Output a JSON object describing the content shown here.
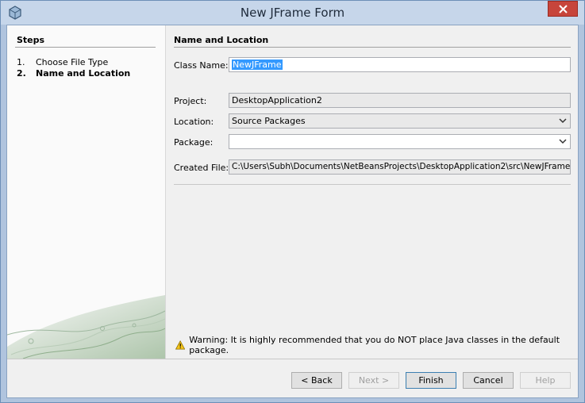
{
  "window": {
    "title": "New JFrame Form"
  },
  "steps": {
    "title": "Steps",
    "items": [
      {
        "num": "1.",
        "label": "Choose File Type",
        "current": false
      },
      {
        "num": "2.",
        "label": "Name and Location",
        "current": true
      }
    ]
  },
  "form": {
    "section_title": "Name and Location",
    "class_name": {
      "label": "Class Name:",
      "value": "NewJFrame"
    },
    "project": {
      "label": "Project:",
      "value": "DesktopApplication2"
    },
    "location": {
      "label": "Location:",
      "value": "Source Packages"
    },
    "package": {
      "label": "Package:",
      "value": ""
    },
    "created_file": {
      "label": "Created File:",
      "value": "C:\\Users\\Subh\\Documents\\NetBeansProjects\\DesktopApplication2\\src\\NewJFrame.java"
    }
  },
  "warning": {
    "text": "Warning: It is highly recommended that you do NOT place Java classes in the default package."
  },
  "buttons": {
    "back": "< Back",
    "next": "Next >",
    "finish": "Finish",
    "cancel": "Cancel",
    "help": "Help"
  },
  "icons": {
    "app": "netbeans-cube-icon",
    "close": "close-icon",
    "chevron": "chevron-down-icon",
    "warning": "warning-icon"
  }
}
